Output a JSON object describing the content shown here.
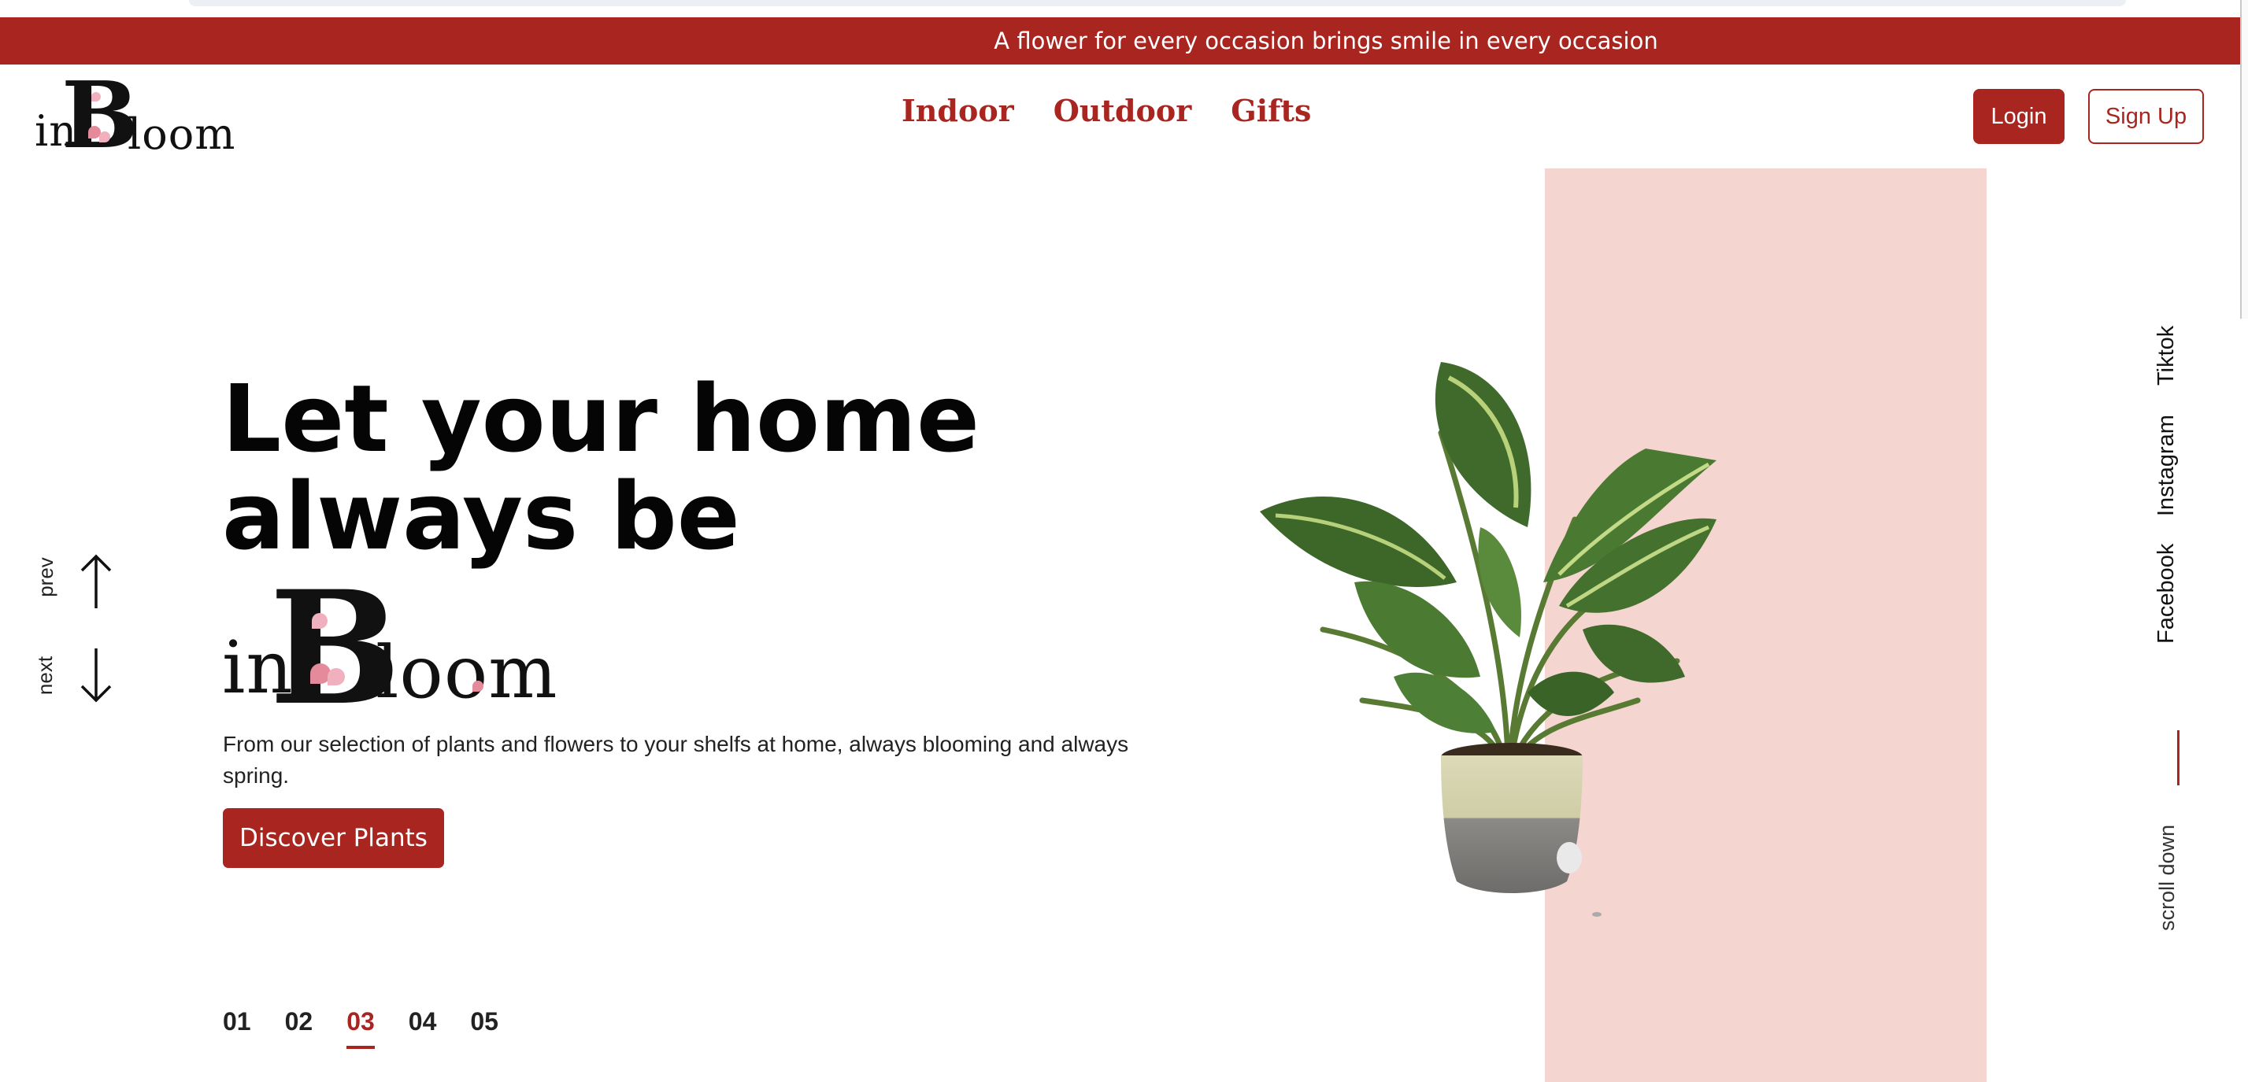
{
  "banner": {
    "text": "A flower for every occasion brings smile in every occasion"
  },
  "logo": {
    "prefix": "in",
    "initial": "B",
    "suffix": "loom"
  },
  "nav": {
    "items": [
      {
        "label": "Indoor"
      },
      {
        "label": "Outdoor"
      },
      {
        "label": "Gifts"
      }
    ]
  },
  "auth": {
    "login_label": "Login",
    "signup_label": "Sign Up"
  },
  "hero": {
    "title_line1": "Let your home",
    "title_line2": "always be",
    "description": "From our selection of plants and flowers to your shelfs at home, always blooming and always spring.",
    "cta_label": "Discover Plants"
  },
  "carousel": {
    "prev_label": "prev",
    "next_label": "next",
    "pages": [
      "01",
      "02",
      "03",
      "04",
      "05"
    ],
    "active_page": "03"
  },
  "social": {
    "links": [
      {
        "label": "Tiktok"
      },
      {
        "label": "Instagram"
      },
      {
        "label": "Facebook"
      }
    ],
    "scroll_label": "scroll down"
  },
  "colors": {
    "accent": "#a82520",
    "panel_pink": "#f4d5d0",
    "leaf_dark": "#3f6a2c",
    "leaf_light": "#b9d27a",
    "pot": "#d8d6b4"
  },
  "icons": [
    "arrow-up-icon",
    "arrow-down-icon",
    "plant-image"
  ]
}
